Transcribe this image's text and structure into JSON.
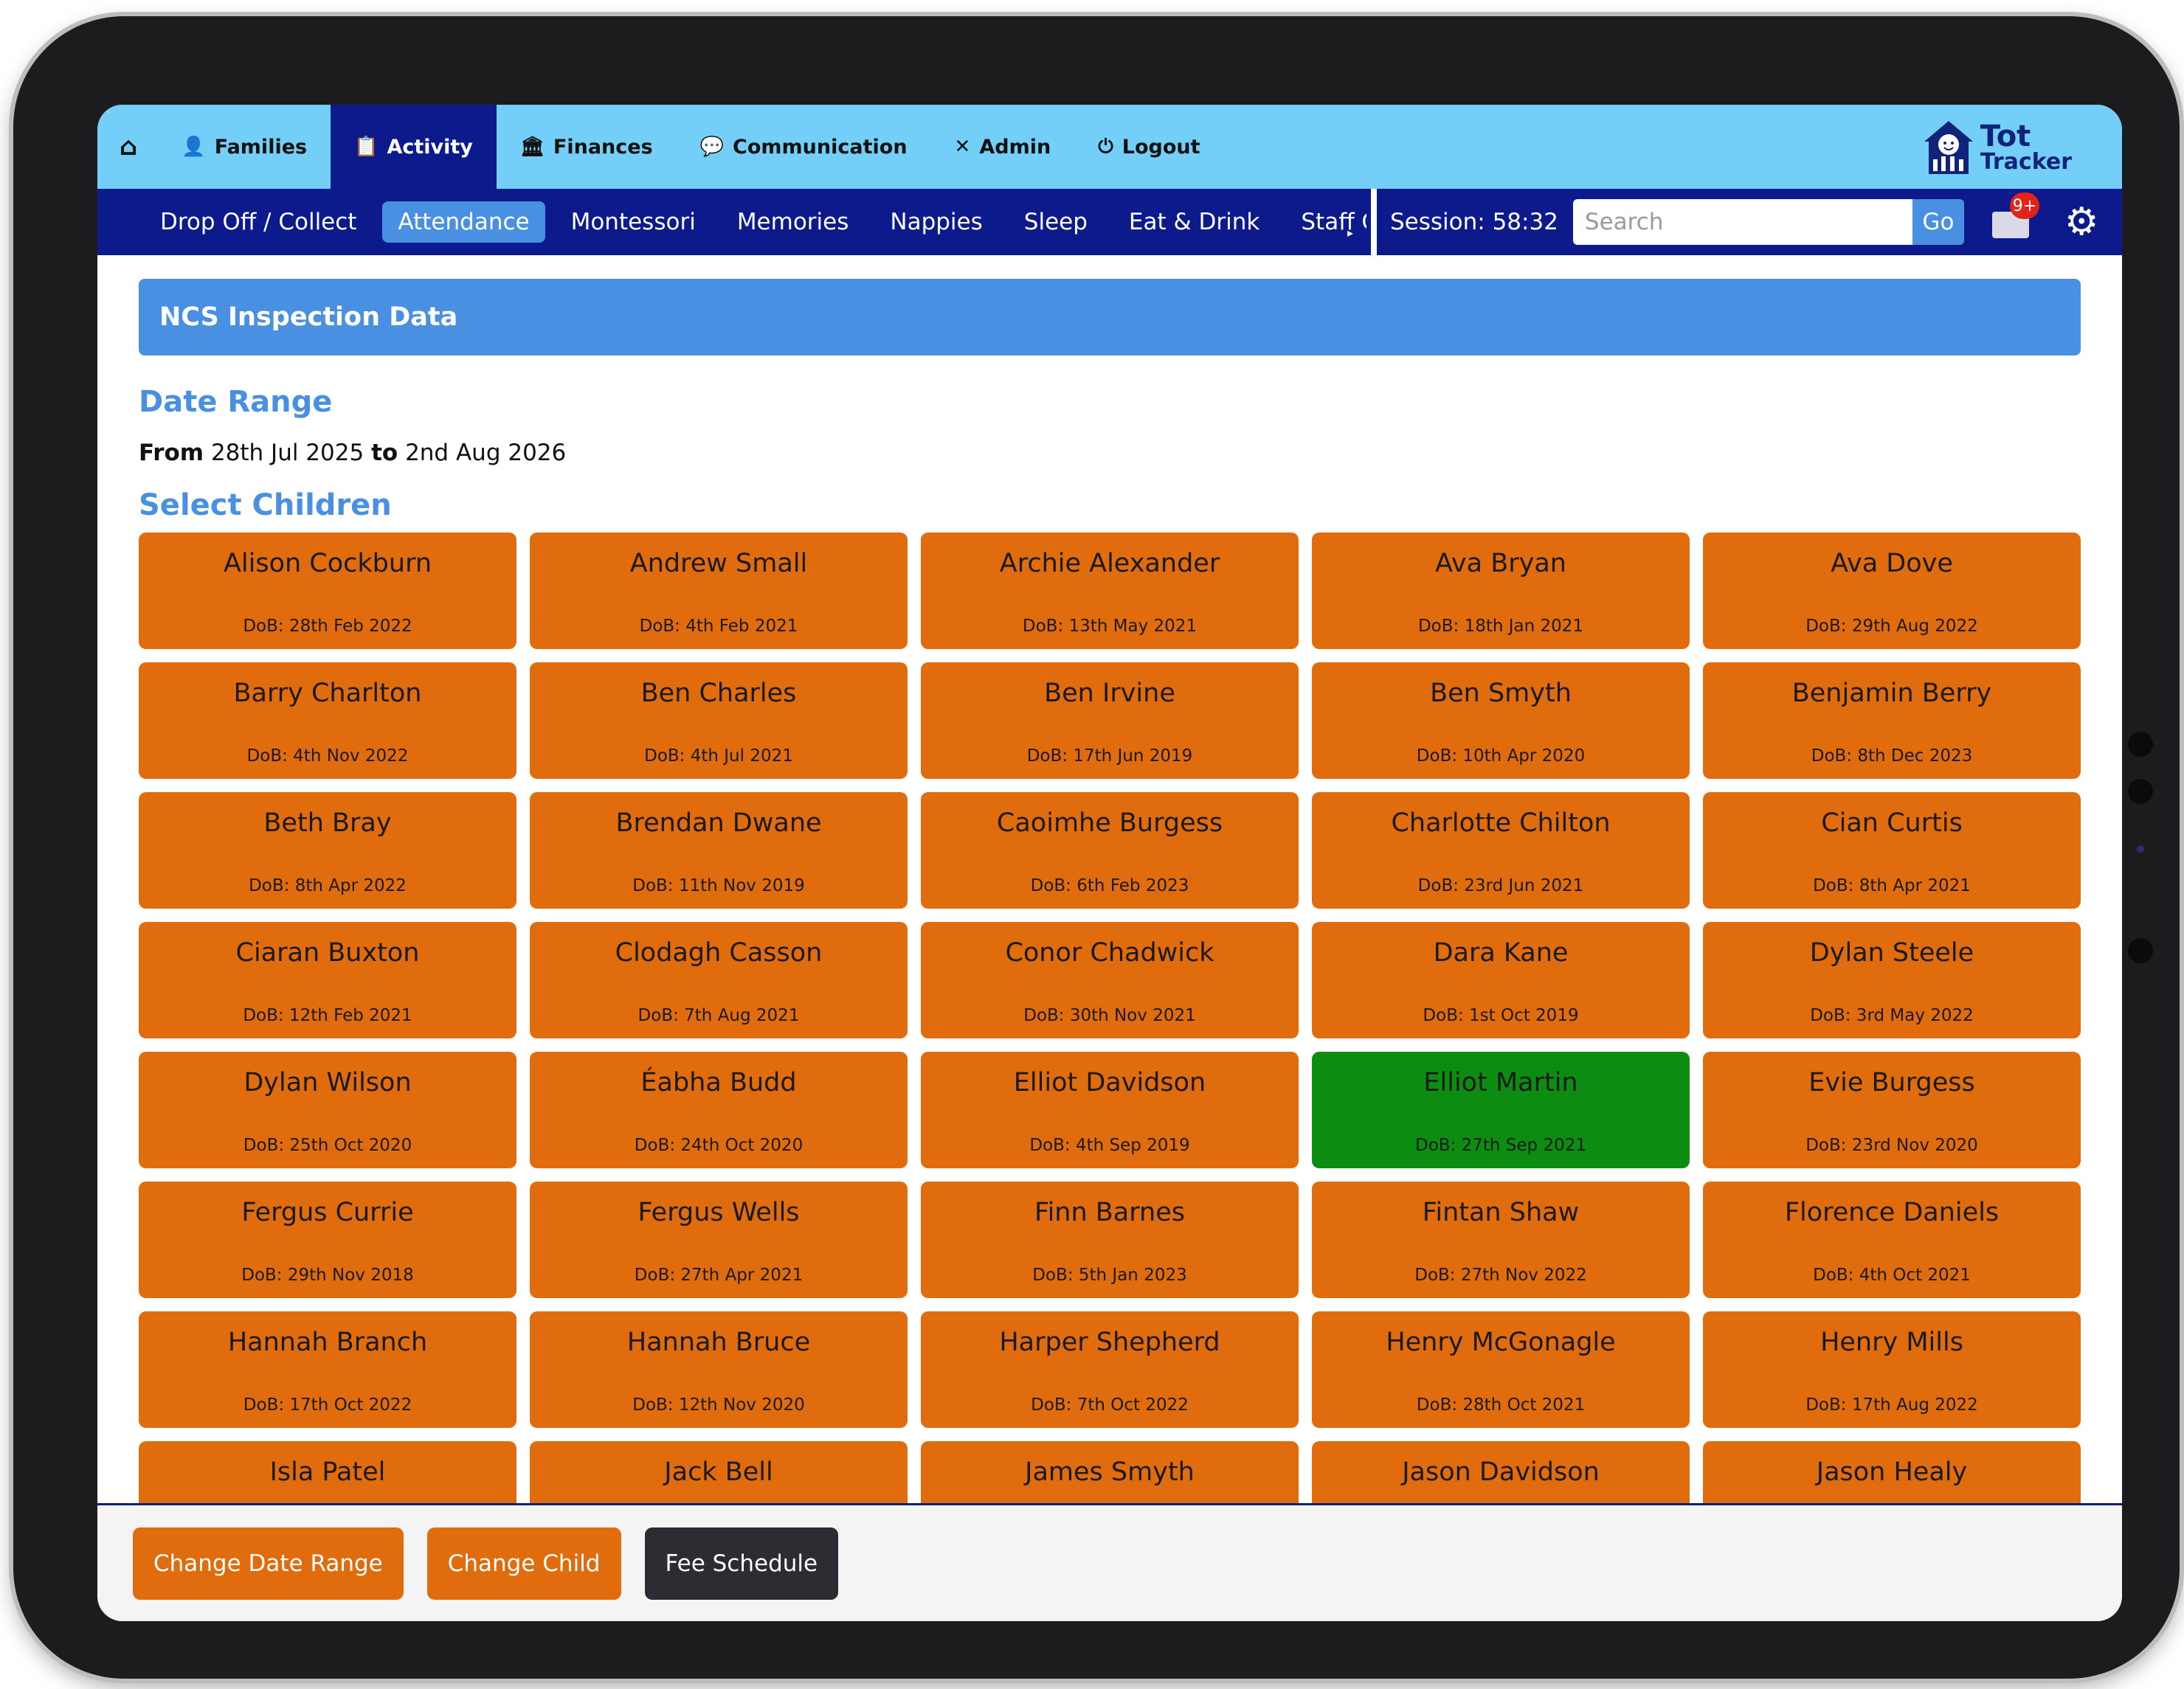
{
  "topnav": {
    "items": [
      {
        "label": "Families",
        "icon": "👤"
      },
      {
        "label": "Activity",
        "icon": "📋"
      },
      {
        "label": "Finances",
        "icon": "🏛"
      },
      {
        "label": "Communication",
        "icon": "💬"
      },
      {
        "label": "Admin",
        "icon": "✕"
      },
      {
        "label": "Logout",
        "icon": "⏻"
      }
    ],
    "active": "Activity",
    "home_icon": "⌂",
    "logo": {
      "line1": "Tot",
      "line2": "Tracker"
    }
  },
  "subnav": {
    "tabs": [
      "Drop Off / Collect",
      "Attendance",
      "Montessori",
      "Memories",
      "Nappies",
      "Sleep",
      "Eat & Drink",
      "Staff Cloc"
    ],
    "active": "Attendance",
    "more_arrow": "▸",
    "session": "Session: 58:32",
    "search_placeholder": "Search",
    "go_label": "Go",
    "mail_badge": "9+",
    "gear_icon": "⚙"
  },
  "main": {
    "panel_title": "NCS Inspection Data",
    "date_range_title": "Date Range",
    "from_label": "From",
    "from_value": "28th Jul 2025",
    "to_label": "to",
    "to_value": "2nd Aug 2026",
    "select_children_title": "Select Children"
  },
  "children": [
    {
      "name": "Alison Cockburn",
      "dob": "DoB: 28th Feb 2022"
    },
    {
      "name": "Andrew Small",
      "dob": "DoB: 4th Feb 2021"
    },
    {
      "name": "Archie Alexander",
      "dob": "DoB: 13th May 2021"
    },
    {
      "name": "Ava Bryan",
      "dob": "DoB: 18th Jan 2021"
    },
    {
      "name": "Ava Dove",
      "dob": "DoB: 29th Aug 2022"
    },
    {
      "name": "Barry Charlton",
      "dob": "DoB: 4th Nov 2022"
    },
    {
      "name": "Ben Charles",
      "dob": "DoB: 4th Jul 2021"
    },
    {
      "name": "Ben Irvine",
      "dob": "DoB: 17th Jun 2019"
    },
    {
      "name": "Ben Smyth",
      "dob": "DoB: 10th Apr 2020"
    },
    {
      "name": "Benjamin Berry",
      "dob": "DoB: 8th Dec 2023"
    },
    {
      "name": "Beth Bray",
      "dob": "DoB: 8th Apr 2022"
    },
    {
      "name": "Brendan Dwane",
      "dob": "DoB: 11th Nov 2019"
    },
    {
      "name": "Caoimhe Burgess",
      "dob": "DoB: 6th Feb 2023"
    },
    {
      "name": "Charlotte Chilton",
      "dob": "DoB: 23rd Jun 2021"
    },
    {
      "name": "Cian Curtis",
      "dob": "DoB: 8th Apr 2021"
    },
    {
      "name": "Ciaran Buxton",
      "dob": "DoB: 12th Feb 2021"
    },
    {
      "name": "Clodagh Casson",
      "dob": "DoB: 7th Aug 2021"
    },
    {
      "name": "Conor Chadwick",
      "dob": "DoB: 30th Nov 2021"
    },
    {
      "name": "Dara Kane",
      "dob": "DoB: 1st Oct 2019"
    },
    {
      "name": "Dylan Steele",
      "dob": "DoB: 3rd May 2022"
    },
    {
      "name": "Dylan Wilson",
      "dob": "DoB: 25th Oct 2020"
    },
    {
      "name": "Éabha Budd",
      "dob": "DoB: 24th Oct 2020"
    },
    {
      "name": "Elliot Davidson",
      "dob": "DoB: 4th Sep 2019"
    },
    {
      "name": "Elliot Martin",
      "dob": "DoB: 27th Sep 2021",
      "selected": true
    },
    {
      "name": "Evie Burgess",
      "dob": "DoB: 23rd Nov 2020"
    },
    {
      "name": "Fergus Currie",
      "dob": "DoB: 29th Nov 2018"
    },
    {
      "name": "Fergus Wells",
      "dob": "DoB: 27th Apr 2021"
    },
    {
      "name": "Finn Barnes",
      "dob": "DoB: 5th Jan 2023"
    },
    {
      "name": "Fintan Shaw",
      "dob": "DoB: 27th Nov 2022"
    },
    {
      "name": "Florence Daniels",
      "dob": "DoB: 4th Oct 2021"
    },
    {
      "name": "Hannah Branch",
      "dob": "DoB: 17th Oct 2022"
    },
    {
      "name": "Hannah Bruce",
      "dob": "DoB: 12th Nov 2020"
    },
    {
      "name": "Harper Shepherd",
      "dob": "DoB: 7th Oct 2022"
    },
    {
      "name": "Henry McGonagle",
      "dob": "DoB: 28th Oct 2021"
    },
    {
      "name": "Henry Mills",
      "dob": "DoB: 17th Aug 2022"
    },
    {
      "name": "Isla Patel",
      "dob": ""
    },
    {
      "name": "Jack Bell",
      "dob": ""
    },
    {
      "name": "James Smyth",
      "dob": ""
    },
    {
      "name": "Jason Davidson",
      "dob": ""
    },
    {
      "name": "Jason Healy",
      "dob": ""
    }
  ],
  "footer": {
    "change_date_range": "Change Date Range",
    "change_child": "Change Child",
    "fee_schedule": "Fee Schedule"
  },
  "colors": {
    "top_nav": "#73cff8",
    "sub_nav": "#0d1a8c",
    "accent_blue": "#4a90e2",
    "child_orange": "#e06c0d",
    "child_selected_green": "#0d8c12",
    "footer_dark": "#2b2d33"
  }
}
